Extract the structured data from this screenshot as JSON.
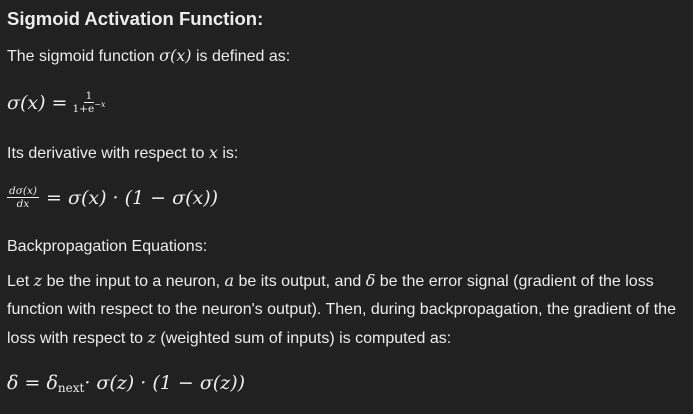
{
  "heading": "Sigmoid Activation Function:",
  "intro": {
    "before": "The sigmoid function ",
    "math": "σ(x)",
    "after": " is defined as:"
  },
  "eq1": {
    "lhs": "σ(x) =",
    "num": "1",
    "den": "1+e",
    "den_sup": "−x"
  },
  "deriv_intro": {
    "before": "Its derivative with respect to ",
    "math": "x",
    "after": " is:"
  },
  "eq2": {
    "num": "dσ(x)",
    "den": "dx",
    "rhs": "= σ(x) · (1 − σ(x))"
  },
  "backprop_label": "Backpropagation Equations:",
  "paragraph": {
    "t1": "Let ",
    "m1": "z",
    "t2": " be the input to a neuron, ",
    "m2": "a",
    "t3": " be its output, and ",
    "m3": "δ",
    "t4": " be the error signal (gradient of the loss function with respect to the neuron's output). Then, during backpropagation, the gradient of the loss with respect to ",
    "m4": "z",
    "t5": " (weighted sum of inputs) is computed as:"
  },
  "eq3": {
    "lhs": "δ = δ",
    "sub": "next",
    "rhs": " · σ(z) · (1 − σ(z))"
  }
}
